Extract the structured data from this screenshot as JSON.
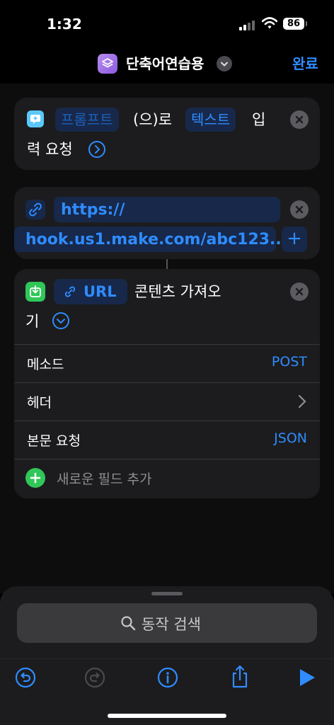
{
  "status_bar": {
    "time": "1:32",
    "battery": "86"
  },
  "nav": {
    "title": "단축어연습용",
    "done": "완료"
  },
  "action1": {
    "token1": "프롬프트",
    "text1": "(으)로",
    "token2": "텍스트",
    "text2": "입",
    "text3": "력 요청"
  },
  "action2": {
    "url_line1": "https://",
    "url_line2": "hook.us1.make.com/abc123...",
    "add": "+"
  },
  "action3": {
    "token": "URL",
    "text1": "콘텐츠 가져오",
    "text2": "기",
    "rows": [
      {
        "label": "메소드",
        "value": "POST"
      },
      {
        "label": "헤더",
        "value": ""
      },
      {
        "label": "본문 요청",
        "value": "JSON"
      }
    ],
    "add_field": "새로운 필드 추가"
  },
  "search": {
    "placeholder": "동작 검색"
  },
  "colors": {
    "accent": "#2f8cff",
    "card": "#1c1c1e",
    "green": "#30c759"
  },
  "icons": {
    "prompt": "ask-input-icon",
    "link": "link-icon",
    "download": "download-icon",
    "undo": "undo-icon",
    "redo": "redo-icon",
    "info": "info-icon",
    "share": "share-icon",
    "play": "play-icon"
  }
}
